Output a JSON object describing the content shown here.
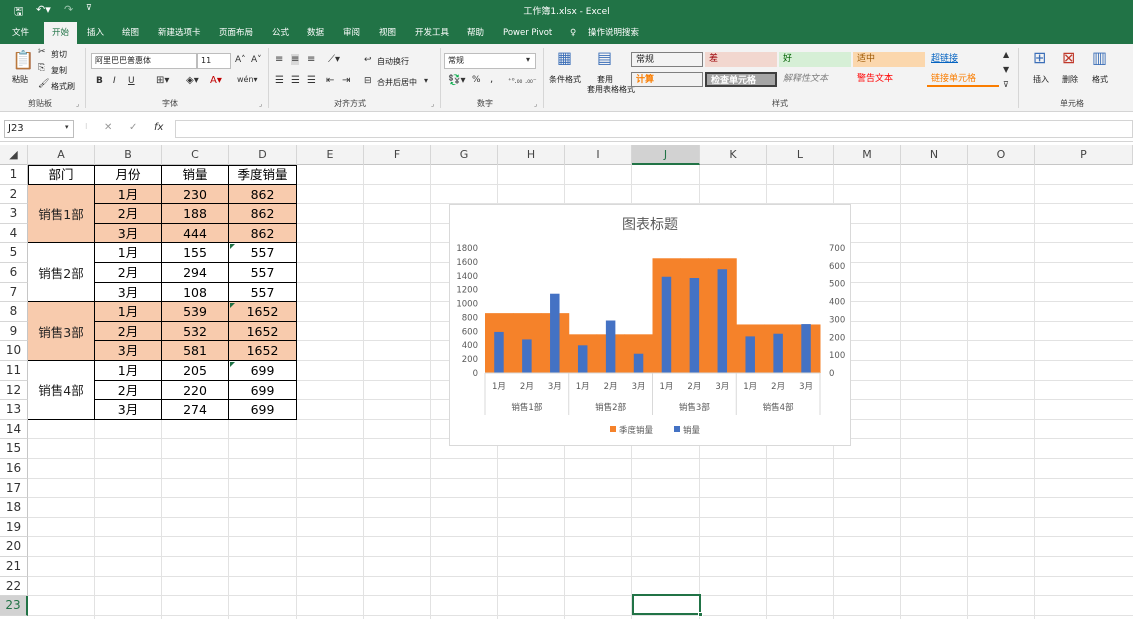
{
  "titlebar": {
    "title": "工作簿1.xlsx  -  Excel"
  },
  "quick_access": {
    "save_icon": "save-icon",
    "undo_icon": "undo-icon",
    "redo_icon": "redo-icon",
    "customize_icon": "customize-icon"
  },
  "tabs": [
    "文件",
    "开始",
    "插入",
    "绘图",
    "新建选项卡",
    "页面布局",
    "公式",
    "数据",
    "审阅",
    "视图",
    "开发工具",
    "帮助",
    "Power Pivot",
    "操作说明搜索"
  ],
  "active_tab": "开始",
  "ribbon": {
    "clipboard": {
      "paste": "粘贴",
      "cut": "剪切",
      "copy": "复制",
      "format_painter": "格式刷",
      "label": "剪贴板"
    },
    "font": {
      "font_name": "阿里巴巴普惠体",
      "font_size": "11",
      "label": "字体",
      "bold": "B",
      "italic": "I",
      "underline": "U"
    },
    "alignment": {
      "wrap": "自动换行",
      "merge": "合并后居中",
      "label": "对齐方式"
    },
    "number": {
      "format": "常规",
      "percent": "%",
      "comma": ",",
      "label": "数字"
    },
    "styles": {
      "conditional": "条件格式",
      "table": "套用表格格式",
      "cells": [
        {
          "text": "常规",
          "bg": "#ffffff",
          "color": "#000000"
        },
        {
          "text": "差",
          "bg": "#f2d7cf",
          "color": "#9c0006"
        },
        {
          "text": "好",
          "bg": "#d6efd6",
          "color": "#006100"
        },
        {
          "text": "适中",
          "bg": "#fbd7ad",
          "color": "#9c5700"
        },
        {
          "text": "超链接",
          "bg": "#ffffff",
          "color": "#0563c1"
        },
        {
          "text": "计算",
          "bg": "#f2f2f2",
          "color": "#fa7d00"
        },
        {
          "text": "检查单元格",
          "bg": "#a5a5a5",
          "color": "#ffffff"
        },
        {
          "text": "解释性文本",
          "bg": "#ffffff",
          "color": "#7f7f7f"
        },
        {
          "text": "警告文本",
          "bg": "#ffffff",
          "color": "#ff0000"
        },
        {
          "text": "链接单元格",
          "bg": "#ffffff",
          "color": "#fa7d00"
        }
      ],
      "label": "样式"
    },
    "cells": {
      "insert": "插入",
      "delete": "删除",
      "format": "格式",
      "label": "单元格"
    }
  },
  "formula_bar": {
    "name_box": "J23",
    "fx": "fx",
    "cancel": "✕",
    "enter": "✓",
    "value": ""
  },
  "columns": [
    "A",
    "B",
    "C",
    "D",
    "E",
    "F",
    "G",
    "H",
    "I",
    "J",
    "K",
    "L",
    "M",
    "N",
    "O",
    "P"
  ],
  "selected_column": "J",
  "rows": [
    "1",
    "2",
    "3",
    "4",
    "5",
    "6",
    "7",
    "8",
    "9",
    "10",
    "11",
    "12",
    "13",
    "14",
    "15",
    "16",
    "17",
    "18",
    "19",
    "20",
    "21",
    "22",
    "23"
  ],
  "selected_row": "23",
  "table": {
    "headers": [
      "部门",
      "月份",
      "销量",
      "季度销量"
    ],
    "departments": [
      "销售1部",
      "销售2部",
      "销售3部",
      "销售4部"
    ],
    "rows": [
      {
        "month": "1月",
        "sales": "230",
        "quarter": "862"
      },
      {
        "month": "2月",
        "sales": "188",
        "quarter": "862"
      },
      {
        "month": "3月",
        "sales": "444",
        "quarter": "862"
      },
      {
        "month": "1月",
        "sales": "155",
        "quarter": "557"
      },
      {
        "month": "2月",
        "sales": "294",
        "quarter": "557"
      },
      {
        "month": "3月",
        "sales": "108",
        "quarter": "557"
      },
      {
        "month": "1月",
        "sales": "539",
        "quarter": "1652"
      },
      {
        "month": "2月",
        "sales": "532",
        "quarter": "1652"
      },
      {
        "month": "3月",
        "sales": "581",
        "quarter": "1652"
      },
      {
        "month": "1月",
        "sales": "205",
        "quarter": "699"
      },
      {
        "month": "2月",
        "sales": "220",
        "quarter": "699"
      },
      {
        "month": "3月",
        "sales": "274",
        "quarter": "699"
      }
    ]
  },
  "chart_data": {
    "type": "bar",
    "title": "图表标题",
    "categories": [
      "1月",
      "2月",
      "3月",
      "1月",
      "2月",
      "3月",
      "1月",
      "2月",
      "3月",
      "1月",
      "2月",
      "3月"
    ],
    "groups": [
      "销售1部",
      "销售2部",
      "销售3部",
      "销售4部"
    ],
    "series": [
      {
        "name": "季度销量",
        "axis": "primary",
        "color": "#f5822a",
        "values": [
          862,
          862,
          862,
          557,
          557,
          557,
          1652,
          1652,
          1652,
          699,
          699,
          699
        ]
      },
      {
        "name": "销量",
        "axis": "secondary",
        "color": "#4472c4",
        "values": [
          230,
          188,
          444,
          155,
          294,
          108,
          539,
          532,
          581,
          205,
          220,
          274
        ]
      }
    ],
    "ylim": [
      0,
      1800
    ],
    "yticks": [
      "0",
      "200",
      "400",
      "600",
      "800",
      "1000",
      "1200",
      "1400",
      "1600",
      "1800"
    ],
    "y2lim": [
      0,
      700
    ],
    "y2ticks": [
      "0",
      "100",
      "200",
      "300",
      "400",
      "500",
      "600",
      "700"
    ],
    "legend": "bottom",
    "grid": false
  }
}
